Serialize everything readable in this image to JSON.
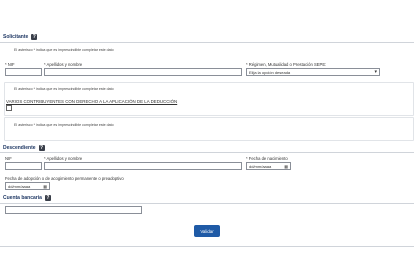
{
  "solicitante": {
    "title": "Solicitante",
    "required_note": "El asterisco * indica que es imprescindible completar este dato",
    "nif_label": "* NIF",
    "apellidos_label": "* Apellidos y nombre",
    "regimen_label": "* Régimen, Mutualidad o Prestación SEPE:",
    "regimen_placeholder": "Elija la opción deseada",
    "panel_note": "El asterisco * indica que es imprescindible completar este dato",
    "varios_label": "VARIOS CONTRIBUYENTES CON DERECHO A LA APLICACIÓN DE LA DEDUCCIÓN",
    "panel_note_2": "El asterisco * indica que es imprescindible completar este dato"
  },
  "descendiente": {
    "title": "Descendiente",
    "nif_label": "NIF",
    "apellidos_label": "* Apellidos y nombre",
    "fecha_nacimiento_label": "* Fecha de nacimiento",
    "fecha_nacimiento_placeholder": "dd/mm/aaaa",
    "fecha_adopcion_label": "Fecha de adopción o de acogimiento permanente o preadoptivo",
    "fecha_adopcion_placeholder": "dd/mm/aaaa"
  },
  "cuenta": {
    "title": "Cuenta bancaria"
  },
  "help_icon": "?",
  "calendar_icon": "calendar-icon",
  "validate_button": "Validar",
  "colors": {
    "accent": "#1f5aa6",
    "title": "#1f3864",
    "help_bg": "#3a3f4a"
  }
}
